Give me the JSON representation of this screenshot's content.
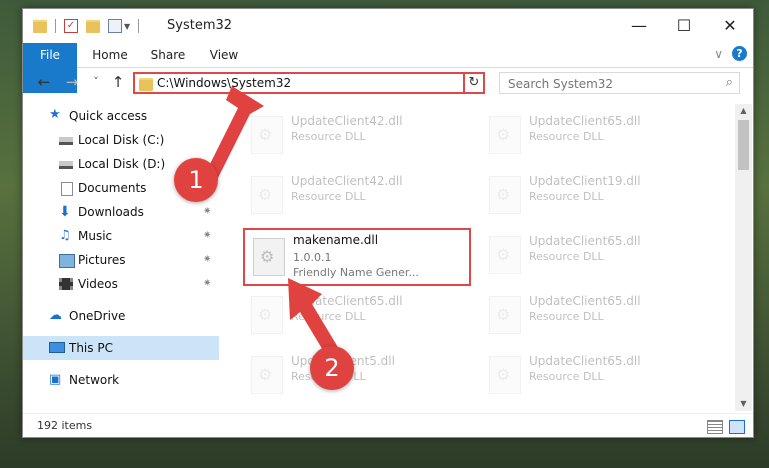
{
  "window": {
    "title": "System32",
    "controls": {
      "minimize": "—",
      "maximize": "☐",
      "close": "✕"
    }
  },
  "ribbon": {
    "tabs": [
      "File",
      "Home",
      "Share",
      "View"
    ],
    "expand_icon": "∨",
    "help_icon": "?"
  },
  "nav": {
    "back": "←",
    "forward": "→",
    "recent": "˅",
    "up": "↑",
    "address": "C:\\Windows\\System32",
    "address_dropdown": "∨",
    "refresh": "↻",
    "search_placeholder": "Search System32",
    "search_icon": "⌕"
  },
  "sidebar": {
    "items": [
      {
        "label": "Quick access",
        "icon": "star-icon",
        "pinned": false
      },
      {
        "label": "Local Disk (C:)",
        "icon": "drive-icon",
        "pinned": false
      },
      {
        "label": "Local Disk (D:)",
        "icon": "drive-icon",
        "pinned": false
      },
      {
        "label": "Documents",
        "icon": "documents-icon",
        "pinned": true
      },
      {
        "label": "Downloads",
        "icon": "downloads-icon",
        "pinned": true
      },
      {
        "label": "Music",
        "icon": "music-icon",
        "pinned": true
      },
      {
        "label": "Pictures",
        "icon": "pictures-icon",
        "pinned": true
      },
      {
        "label": "Videos",
        "icon": "videos-icon",
        "pinned": true
      },
      {
        "label": "OneDrive",
        "icon": "onedrive-icon",
        "pinned": false
      },
      {
        "label": "This PC",
        "icon": "pc-icon",
        "pinned": false,
        "selected": true
      },
      {
        "label": "Network",
        "icon": "network-icon",
        "pinned": false
      }
    ],
    "pin_glyph": "✷"
  },
  "files": {
    "left": [
      {
        "name": "UpdateClient42.dll",
        "desc": "Resource DLL"
      },
      {
        "name": "UpdateClient42.dll",
        "desc": "Resource DLL"
      },
      {
        "name": "UpdateClient65.dll",
        "desc": "Resource DLL"
      },
      {
        "name": "UpdateClient5.dll",
        "desc": "Resource DLL"
      }
    ],
    "right": [
      {
        "name": "UpdateClient65.dll",
        "desc": "Resource DLL"
      },
      {
        "name": "UpdateClient19.dll",
        "desc": "Resource DLL"
      },
      {
        "name": "UpdateClient65.dll",
        "desc": "Resource DLL"
      },
      {
        "name": "UpdateClient65.dll",
        "desc": "Resource DLL"
      },
      {
        "name": "UpdateClient65.dll",
        "desc": "Resource DLL"
      }
    ],
    "focus": {
      "name": "makename.dll",
      "version": "1.0.0.1",
      "desc": "Friendly Name Gener..."
    }
  },
  "status": {
    "count": "192 items"
  },
  "annotations": {
    "step1": "1",
    "step2": "2"
  },
  "colors": {
    "accent": "#1979ca",
    "highlight": "#e04848",
    "selection": "#cce4f7"
  }
}
